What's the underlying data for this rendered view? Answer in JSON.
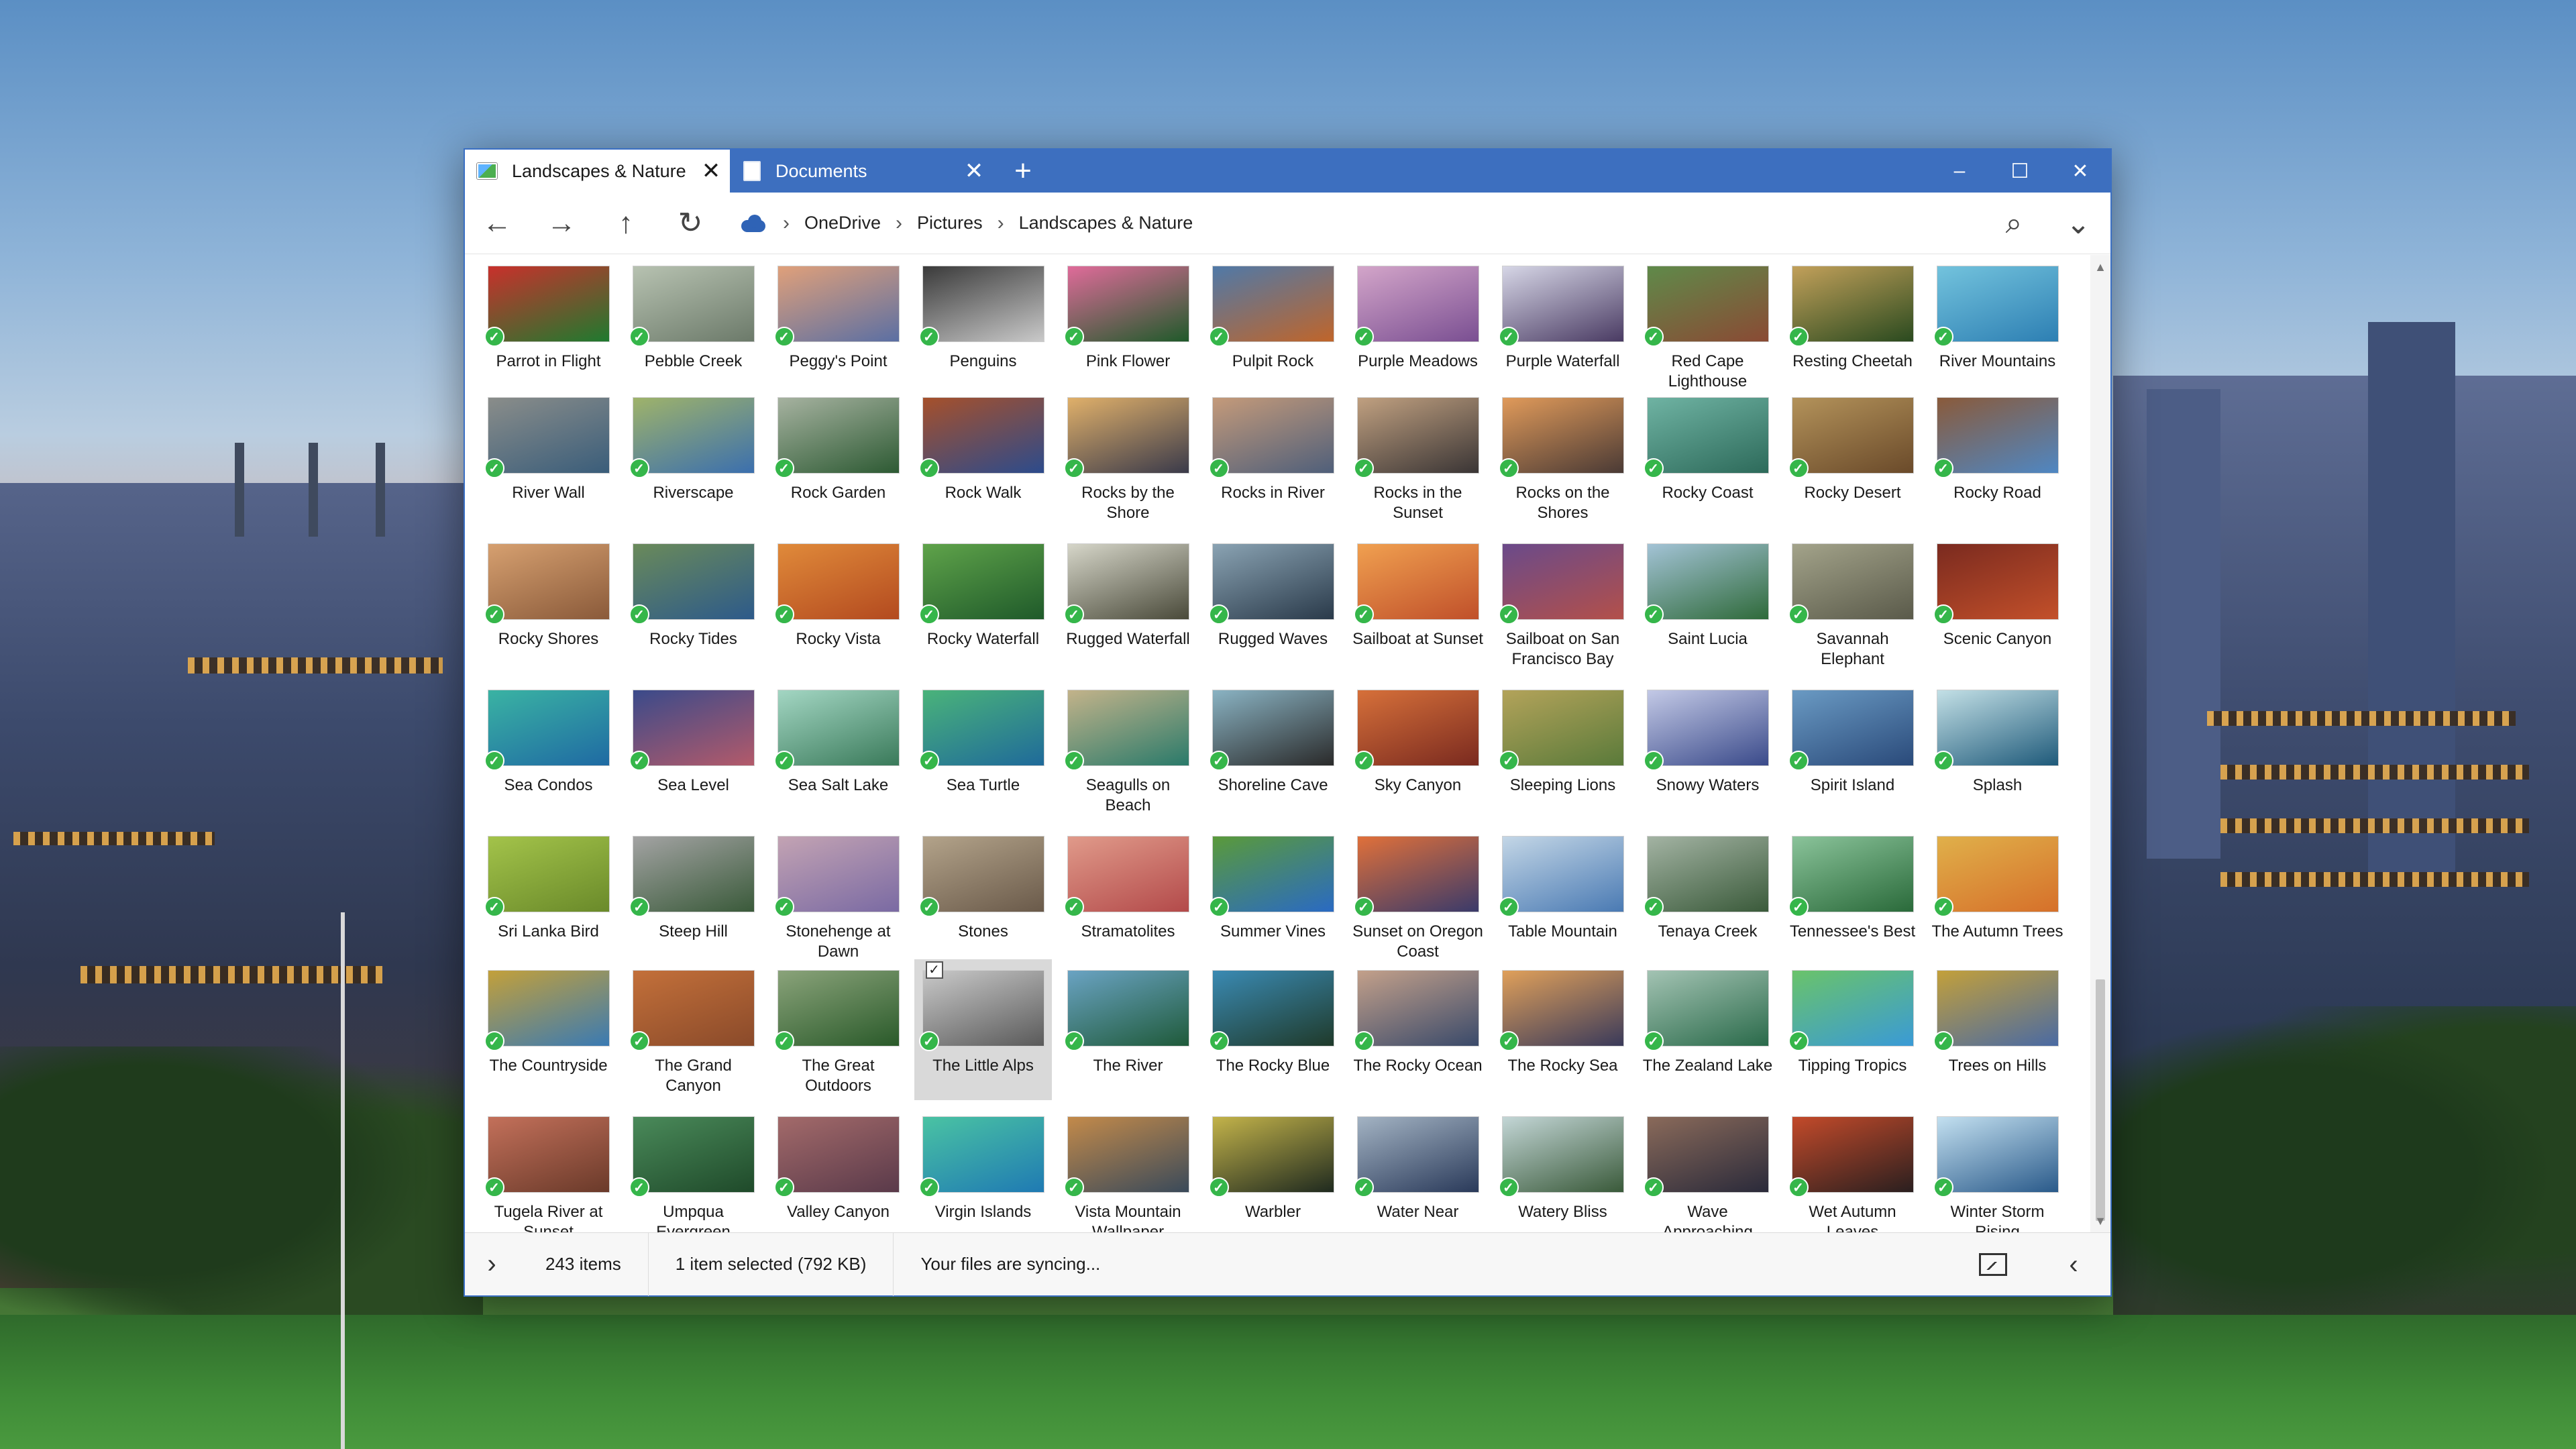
{
  "window": {
    "tabs": [
      {
        "label": "Landscapes & Nature",
        "active": true,
        "icon": "photo-icon"
      },
      {
        "label": "Documents",
        "active": false,
        "icon": "document-icon"
      }
    ],
    "new_tab_label": "+",
    "controls": {
      "minimize": "–",
      "maximize": "☐",
      "close": "✕"
    }
  },
  "navbar": {
    "back": "←",
    "forward": "→",
    "up": "↑",
    "refresh": "↻",
    "breadcrumbs": [
      "OneDrive",
      "Pictures",
      "Landscapes & Nature"
    ],
    "separator": "›",
    "search_icon": "⌕",
    "more_icon": "⌄"
  },
  "status": {
    "expand": "›",
    "item_count": "243 items",
    "selection": "1 item selected (792 KB)",
    "sync": "Your files are syncing...",
    "collapse": "‹"
  },
  "colors": {
    "titlebar": "#3d6fbf",
    "check": "#35b64a",
    "selected": "#d9d9d9"
  },
  "items": [
    {
      "label": "Parrot in Flight",
      "c1": "#1f7a2f",
      "c2": "#c9302c"
    },
    {
      "label": "Pebble Creek",
      "c1": "#6c7a6a",
      "c2": "#b7c2b1"
    },
    {
      "label": "Peggy's Point",
      "c1": "#5b6fa3",
      "c2": "#e0a07a"
    },
    {
      "label": "Penguins",
      "c1": "#c9c9c9",
      "c2": "#3a3a3a"
    },
    {
      "label": "Pink Flower",
      "c1": "#1f5a2a",
      "c2": "#e06b9a"
    },
    {
      "label": "Pulpit Rock",
      "c1": "#c0652a",
      "c2": "#4f79a8"
    },
    {
      "label": "Purple Meadows",
      "c1": "#7a4f92",
      "c2": "#d3a5c9"
    },
    {
      "label": "Purple Waterfall",
      "c1": "#4a3b63",
      "c2": "#d6d6e6"
    },
    {
      "label": "Red Cape Lighthouse",
      "c1": "#8a4a34",
      "c2": "#5f8a4a"
    },
    {
      "label": "Resting Cheetah",
      "c1": "#2a4a1f",
      "c2": "#c2a05a"
    },
    {
      "label": "River Mountains",
      "c1": "#2d7fb3",
      "c2": "#73c3dd"
    },
    {
      "label": "River Wall",
      "c1": "#3a5d7a",
      "c2": "#8a8d8a"
    },
    {
      "label": "Riverscape",
      "c1": "#3b6fae",
      "c2": "#9fb36a"
    },
    {
      "label": "Rock Garden",
      "c1": "#2d5a33",
      "c2": "#a6b2a0"
    },
    {
      "label": "Rock Walk",
      "c1": "#2c4b8c",
      "c2": "#a6502b"
    },
    {
      "label": "Rocks by the Shore",
      "c1": "#3a3a4a",
      "c2": "#e0b06a"
    },
    {
      "label": "Rocks in River",
      "c1": "#4f5f7a",
      "c2": "#c49a7a"
    },
    {
      "label": "Rocks in the Sunset",
      "c1": "#3a3535",
      "c2": "#c0a080"
    },
    {
      "label": "Rocks on the Shores",
      "c1": "#4a3a35",
      "c2": "#e09a5a"
    },
    {
      "label": "Rocky Coast",
      "c1": "#2d6a5a",
      "c2": "#6fb3a3"
    },
    {
      "label": "Rocky Desert",
      "c1": "#6a4a2a",
      "c2": "#b3925a"
    },
    {
      "label": "Rocky Road",
      "c1": "#4f87c3",
      "c2": "#8a5a3a"
    },
    {
      "label": "Rocky Shores",
      "c1": "#8a5a3a",
      "c2": "#d6a070"
    },
    {
      "label": "Rocky Tides",
      "c1": "#2d5a8a",
      "c2": "#6a8a5a"
    },
    {
      "label": "Rocky Vista",
      "c1": "#b34a1f",
      "c2": "#e08a3a"
    },
    {
      "label": "Rocky Waterfall",
      "c1": "#1f5a2a",
      "c2": "#5fa34a"
    },
    {
      "label": "Rugged Waterfall",
      "c1": "#4a4a3a",
      "c2": "#d6d6c9"
    },
    {
      "label": "Rugged Waves",
      "c1": "#2a3a4a",
      "c2": "#8aa3b3"
    },
    {
      "label": "Sailboat at Sunset",
      "c1": "#c0502a",
      "c2": "#f0a050"
    },
    {
      "label": "Sailboat on San Francisco Bay",
      "c1": "#b3504a",
      "c2": "#6a4a8a"
    },
    {
      "label": "Saint Lucia",
      "c1": "#2f6a3a",
      "c2": "#a3c3d6"
    },
    {
      "label": "Savannah Elephant",
      "c1": "#5a5a4a",
      "c2": "#a3a38a"
    },
    {
      "label": "Scenic Canyon",
      "c1": "#c3502a",
      "c2": "#7a2a1f"
    },
    {
      "label": "Sea Condos",
      "c1": "#1f6aa3",
      "c2": "#3ab3a3"
    },
    {
      "label": "Sea Level",
      "c1": "#b35a6a",
      "c2": "#3a4a8a"
    },
    {
      "label": "Sea Salt Lake",
      "c1": "#3a7a5a",
      "c2": "#a3d6c3"
    },
    {
      "label": "Sea Turtle",
      "c1": "#1f6a9a",
      "c2": "#4ab37a"
    },
    {
      "label": "Seagulls on Beach",
      "c1": "#2a7a6a",
      "c2": "#c3b38a"
    },
    {
      "label": "Shoreline Cave",
      "c1": "#2a2a2a",
      "c2": "#8ab3c3"
    },
    {
      "label": "Sky Canyon",
      "c1": "#7a2a1f",
      "c2": "#d6703a"
    },
    {
      "label": "Sleeping Lions",
      "c1": "#5a7a3a",
      "c2": "#b3a35a"
    },
    {
      "label": "Snowy Waters",
      "c1": "#3a4a8a",
      "c2": "#c3c9e6"
    },
    {
      "label": "Spirit Island",
      "c1": "#2a4a7a",
      "c2": "#6a9ac3"
    },
    {
      "label": "Splash",
      "c1": "#1f5a7a",
      "c2": "#c3e0e6"
    },
    {
      "label": "Sri Lanka Bird",
      "c1": "#6a8a2a",
      "c2": "#a3c34a"
    },
    {
      "label": "Steep Hill",
      "c1": "#3a5a3a",
      "c2": "#a3a3a3"
    },
    {
      "label": "Stonehenge at Dawn",
      "c1": "#7a6aa3",
      "c2": "#c3a3b3"
    },
    {
      "label": "Stones",
      "c1": "#6a5a4a",
      "c2": "#b3a38a"
    },
    {
      "label": "Stramatolites",
      "c1": "#b34a4a",
      "c2": "#e09a8a"
    },
    {
      "label": "Summer Vines",
      "c1": "#2a6ac3",
      "c2": "#5a9a3a"
    },
    {
      "label": "Sunset on Oregon Coast",
      "c1": "#3a3a6a",
      "c2": "#e0703a"
    },
    {
      "label": "Table Mountain",
      "c1": "#4a7ab3",
      "c2": "#c3d6e6"
    },
    {
      "label": "Tenaya Creek",
      "c1": "#3a5a3a",
      "c2": "#a3b3a3"
    },
    {
      "label": "Tennessee's Best",
      "c1": "#2a6a3a",
      "c2": "#8ac39a"
    },
    {
      "label": "The Autumn Trees",
      "c1": "#d6702a",
      "c2": "#e0b04a"
    },
    {
      "label": "The Countryside",
      "c1": "#3a7ab3",
      "c2": "#c3a03a"
    },
    {
      "label": "The Grand Canyon",
      "c1": "#8a4a2a",
      "c2": "#c3703a"
    },
    {
      "label": "The Great Outdoors",
      "c1": "#2a5a2a",
      "c2": "#8aa37a"
    },
    {
      "label": "The Little Alps",
      "c1": "#5a5a5a",
      "c2": "#c9c9c9"
    },
    {
      "label": "The River",
      "c1": "#1f5a3a",
      "c2": "#6aa3c3"
    },
    {
      "label": "The Rocky Blue",
      "c1": "#1f3a2a",
      "c2": "#3a8ab3"
    },
    {
      "label": "The Rocky Ocean",
      "c1": "#3a4a6a",
      "c2": "#c3a08a"
    },
    {
      "label": "The Rocky Sea",
      "c1": "#3a3a5a",
      "c2": "#e0a05a"
    },
    {
      "label": "The Zealand Lake",
      "c1": "#2a6a4a",
      "c2": "#a3c3b3"
    },
    {
      "label": "Tipping Tropics",
      "c1": "#3a9ad6",
      "c2": "#6ac36a"
    },
    {
      "label": "Trees on Hills",
      "c1": "#4a6aa3",
      "c2": "#c3a03a"
    },
    {
      "label": "Tugela River at Sunset",
      "c1": "#6a3a2a",
      "c2": "#c3705a"
    },
    {
      "label": "Umpqua Evergreen",
      "c1": "#1f4a2a",
      "c2": "#4a8a5a"
    },
    {
      "label": "Valley Canyon",
      "c1": "#5a3a4a",
      "c2": "#a36a6a"
    },
    {
      "label": "Virgin Islands",
      "c1": "#1f7ab3",
      "c2": "#4ac3a3"
    },
    {
      "label": "Vista Mountain Wallpaper",
      "c1": "#3a4a5a",
      "c2": "#c38a4a"
    },
    {
      "label": "Warbler",
      "c1": "#1f2a1f",
      "c2": "#c3b34a"
    },
    {
      "label": "Water Near",
      "c1": "#2a3a5a",
      "c2": "#a3b3c3"
    },
    {
      "label": "Watery Bliss",
      "c1": "#3a5a3a",
      "c2": "#c3d6d6"
    },
    {
      "label": "Wave Approaching",
      "c1": "#2a2a3a",
      "c2": "#8a6a5a"
    },
    {
      "label": "Wet Autumn Leaves",
      "c1": "#2a1f1f",
      "c2": "#c34a2a"
    },
    {
      "label": "Winter Storm Rising",
      "c1": "#2a5a8a",
      "c2": "#c3e0f0"
    }
  ],
  "selected_index": 58
}
